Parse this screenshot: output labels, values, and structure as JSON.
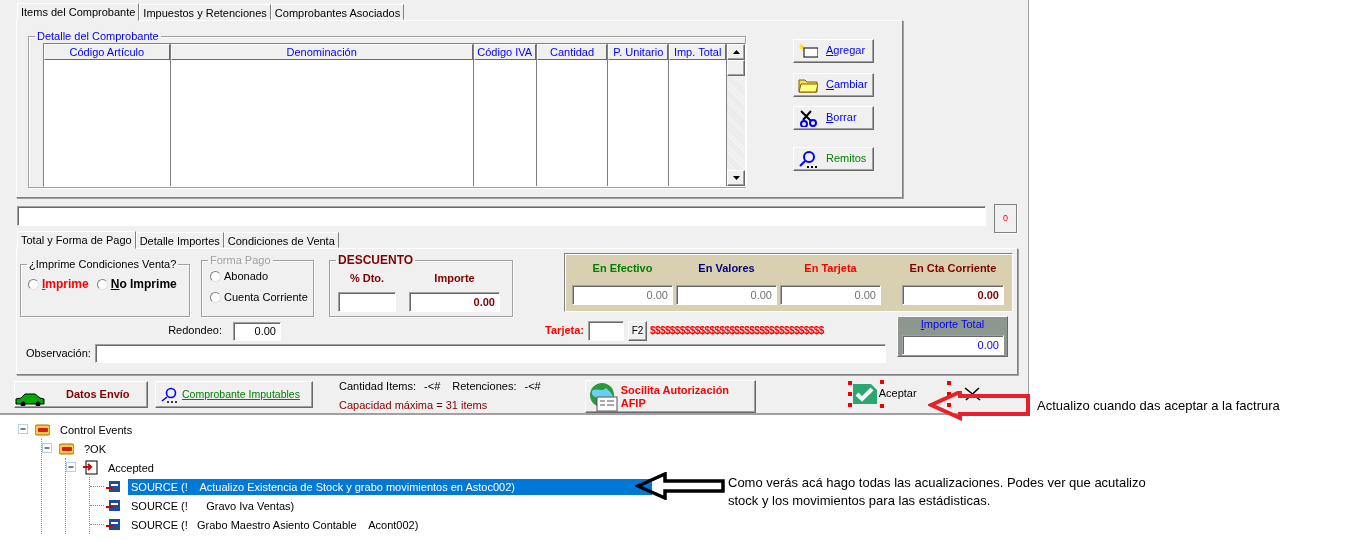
{
  "top_tabs": [
    {
      "label": "Items del Comprobante",
      "selected": true
    },
    {
      "label": "Impuestos y Retenciones",
      "selected": false
    },
    {
      "label": "Comprobantes Asociados",
      "selected": false
    }
  ],
  "detail": {
    "legend": "Detalle del Comprobante",
    "columns": [
      "Código Artículo",
      "Denominación",
      "Código IVA",
      "Cantidad",
      "P. Unitario",
      "Imp. Total"
    ]
  },
  "side_buttons": [
    {
      "label": "Agregar",
      "kind": "add",
      "mnemonic": true,
      "color": "#0000ff"
    },
    {
      "label": "Cambiar",
      "kind": "folder",
      "mnemonic": true,
      "color": "#0000ff"
    },
    {
      "label": "Borrar",
      "kind": "cut",
      "mnemonic": true,
      "color": "#0000ff"
    },
    {
      "label": "Remitos",
      "kind": "search",
      "mnemonic": false,
      "color": "#008000"
    }
  ],
  "counter": "0",
  "bottom_tabs": [
    {
      "label": "Total y Forma de Pago",
      "selected": true
    },
    {
      "label": "Detalle Importes",
      "selected": false
    },
    {
      "label": "Condiciones de Venta",
      "selected": false
    }
  ],
  "print_conditions": {
    "legend": "¿Imprime Condiciones Venta?",
    "options": [
      {
        "label": "Imprime",
        "selected": false,
        "mnemonic": true,
        "color": "#ff0000"
      },
      {
        "label": "No Imprime",
        "selected": false,
        "mnemonic": true,
        "color": "#000000"
      }
    ]
  },
  "payment_form": {
    "legend": "Forma Pago",
    "disabled": true,
    "options": [
      {
        "label": "Abonado",
        "selected": false
      },
      {
        "label": "Cuenta Corriente",
        "selected": false
      }
    ]
  },
  "discount": {
    "legend": "DESCUENTO",
    "percent_label": "% Dto.",
    "amount_label": "Importe",
    "amount": "0.00"
  },
  "payments": [
    {
      "label": "En Efectivo",
      "color": "#008000",
      "value": "0.00",
      "highlighted": false
    },
    {
      "label": "En Valores",
      "color": "#000080",
      "value": "0.00",
      "highlighted": false
    },
    {
      "label": "En Tarjeta",
      "color": "#ff0000",
      "value": "0.00",
      "highlighted": false
    },
    {
      "label": "En Cta Corriente",
      "color": "#800000",
      "value": "0.00",
      "highlighted": true
    }
  ],
  "rounding": {
    "label": "Redondeo:",
    "value": "0.00"
  },
  "card": {
    "label": "Tarjeta:",
    "key": "F2",
    "mask": "$$$$$$$$$$$$$$$$$$$$$$$$$$$$$$$$$$$"
  },
  "total": {
    "label": "Importe Total",
    "value": "0.00"
  },
  "observation": {
    "label": "Observación:"
  },
  "footer": {
    "shipping_button": "Datos Envío",
    "imputables_button": "Comprobante Imputables",
    "stats": [
      {
        "label": "Cantidad Items:",
        "value": "-<#"
      },
      {
        "label": "Retenciones:",
        "value": "-<#"
      }
    ],
    "capacity": "Capacidad máxima = 31 items",
    "afip_button": "Socilita Autorización AFIP",
    "accept_button": "Aceptar"
  },
  "tree": [
    {
      "label": "Control Events",
      "kind": "folder",
      "expanded": true,
      "selected": false,
      "children": [
        {
          "label": "?OK",
          "kind": "folder",
          "expanded": true,
          "selected": false,
          "children": [
            {
              "label": "Accepted",
              "kind": "event",
              "expanded": true,
              "selected": false,
              "children": [
                {
                  "label": "SOURCE (!    Actualizo Existencia de Stock y grabo movimientos en Astoc002)",
                  "kind": "code",
                  "selected": true
                },
                {
                  "label": "SOURCE (!      Gravo Iva Ventas)",
                  "kind": "code",
                  "selected": false
                },
                {
                  "label": "SOURCE (!   Grabo Maestro Asiento Contable    Acont002)",
                  "kind": "code",
                  "selected": false
                }
              ]
            }
          ]
        }
      ]
    }
  ],
  "annotations": [
    {
      "kind": "red",
      "text": "Actualizo cuando das aceptar a la factrura"
    },
    {
      "kind": "black",
      "text": "Como verás acá hago  todas las acualizaciones. Podes ver que acutalizo stock y los movimientos para las estádisticas."
    }
  ]
}
